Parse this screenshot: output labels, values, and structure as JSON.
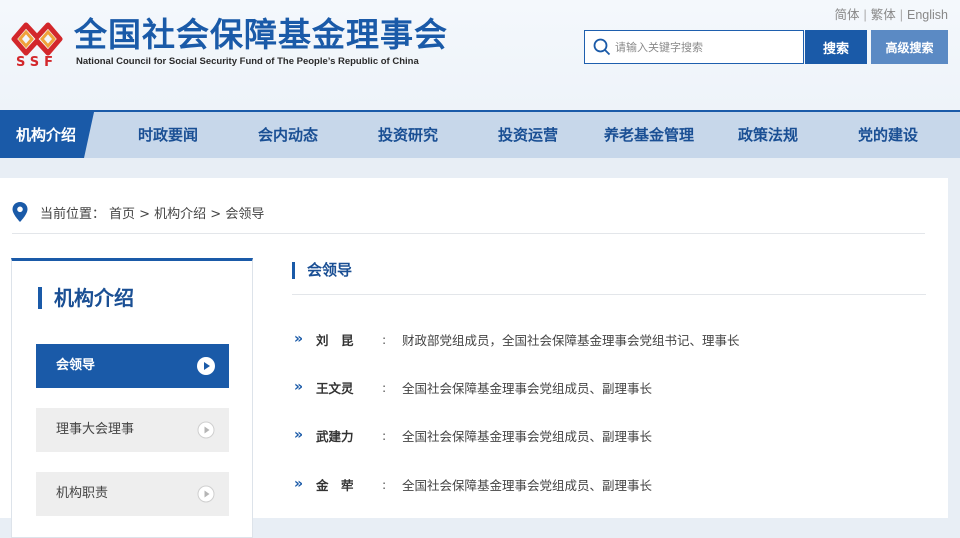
{
  "header": {
    "logo_text": "SSF",
    "title": "全国社会保障基金理事会",
    "subtitle": "National Council for Social Security Fund of The People’s Republic of China",
    "languages": [
      "简体",
      "繁体",
      "English"
    ],
    "search_placeholder": "请输入关键字搜索",
    "search_button": "搜索",
    "advanced_search_button": "高级搜索",
    "brand_color": "#1a5aa8",
    "logo_color": "#d3272b"
  },
  "nav": {
    "items": [
      {
        "label": "机构介绍",
        "active": true
      },
      {
        "label": "时政要闻"
      },
      {
        "label": "会内动态"
      },
      {
        "label": "投资研究"
      },
      {
        "label": "投资运营"
      },
      {
        "label": "养老基金管理"
      },
      {
        "label": "政策法规"
      },
      {
        "label": "党的建设"
      }
    ]
  },
  "breadcrumb": {
    "prefix": "当前位置：",
    "path": "首页 > 机构介绍 > 会领导"
  },
  "sidebar": {
    "title": "机构介绍",
    "items": [
      {
        "label": "会领导",
        "active": true
      },
      {
        "label": "理事大会理事"
      },
      {
        "label": "机构职责"
      }
    ]
  },
  "content": {
    "section_title": "会领导",
    "leaders": [
      {
        "name": "刘　昆",
        "role": "财政部党组成员，全国社会保障基金理事会党组书记、理事长"
      },
      {
        "name": "王文灵",
        "role": "全国社会保障基金理事会党组成员、副理事长"
      },
      {
        "name": "武建力",
        "role": "全国社会保障基金理事会党组成员、副理事长"
      },
      {
        "name": "金　荦",
        "role": "全国社会保障基金理事会党组成员、副理事长"
      }
    ]
  }
}
